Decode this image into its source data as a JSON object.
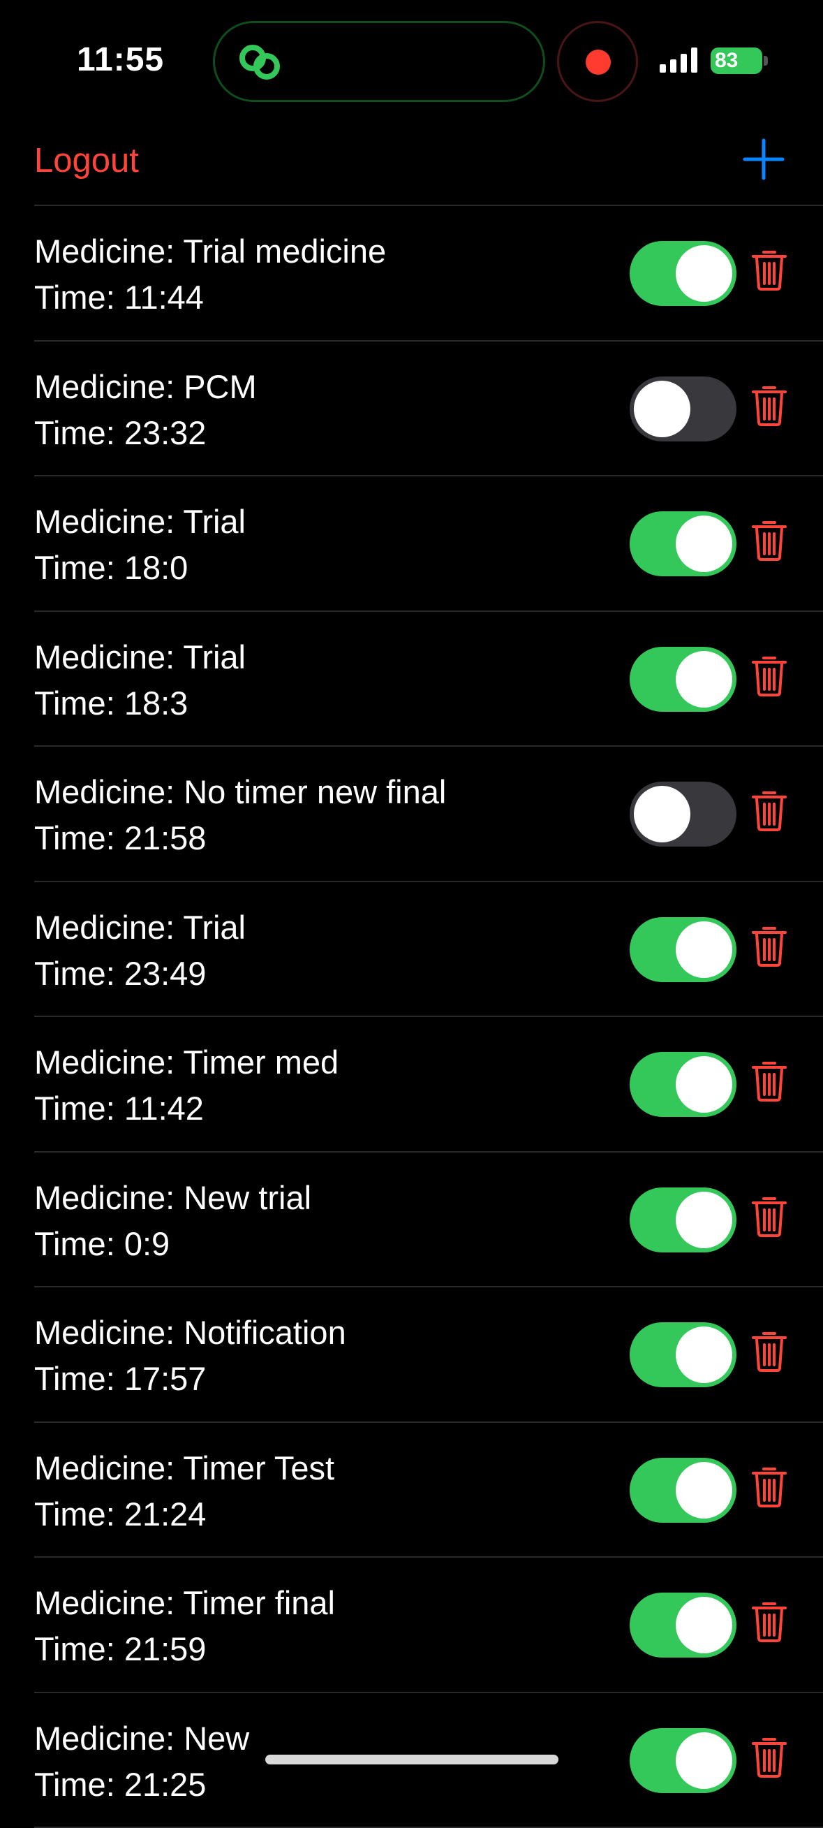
{
  "status_bar": {
    "time": "11:55",
    "battery": "83"
  },
  "nav": {
    "logout_label": "Logout",
    "add_label": "+"
  },
  "colors": {
    "accent_red": "#ff453a",
    "accent_blue": "#0a84ff",
    "toggle_on": "#34c759",
    "toggle_off": "#39393d"
  },
  "reminders": [
    {
      "medicine": "Medicine: Trial medicine",
      "time": "Time: 11:44",
      "enabled": true
    },
    {
      "medicine": "Medicine: PCM",
      "time": "Time: 23:32",
      "enabled": false
    },
    {
      "medicine": "Medicine: Trial",
      "time": "Time: 18:0",
      "enabled": true
    },
    {
      "medicine": "Medicine: Trial",
      "time": "Time: 18:3",
      "enabled": true
    },
    {
      "medicine": "Medicine: No timer new final",
      "time": "Time: 21:58",
      "enabled": false
    },
    {
      "medicine": "Medicine: Trial",
      "time": "Time: 23:49",
      "enabled": true
    },
    {
      "medicine": "Medicine: Timer med",
      "time": "Time: 11:42",
      "enabled": true
    },
    {
      "medicine": "Medicine: New trial",
      "time": "Time: 0:9",
      "enabled": true
    },
    {
      "medicine": "Medicine: Notification",
      "time": "Time: 17:57",
      "enabled": true
    },
    {
      "medicine": "Medicine: Timer Test",
      "time": "Time: 21:24",
      "enabled": true
    },
    {
      "medicine": "Medicine: Timer final",
      "time": "Time: 21:59",
      "enabled": true
    },
    {
      "medicine": "Medicine: New",
      "time": "Time: 21:25",
      "enabled": true
    }
  ]
}
